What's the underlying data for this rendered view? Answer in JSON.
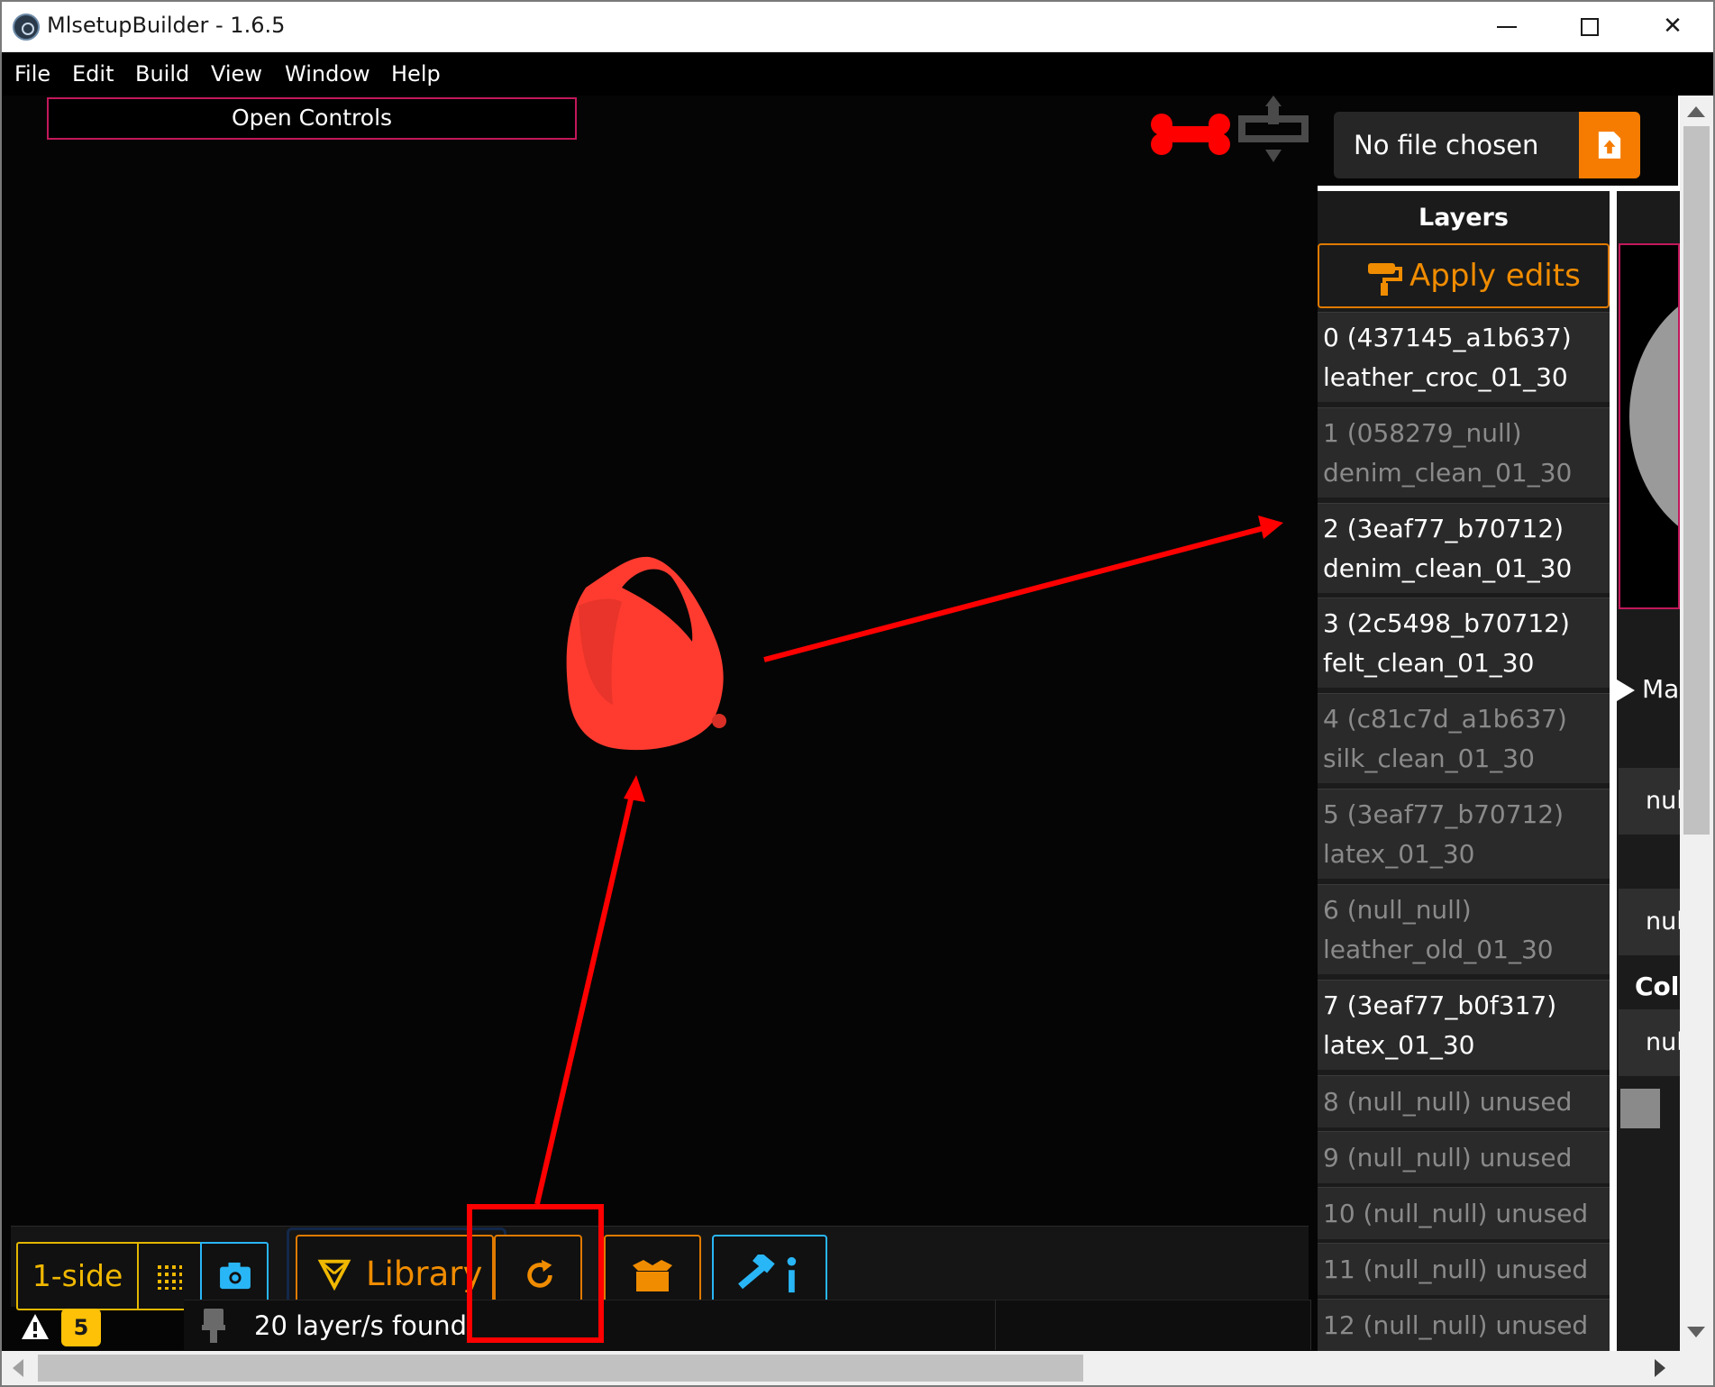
{
  "window": {
    "title": "MlsetupBuilder - 1.6.5",
    "controls": {
      "minimize": "minimize",
      "maximize": "maximize",
      "close": "✕"
    }
  },
  "menu": {
    "items": [
      "File",
      "Edit",
      "Build",
      "View",
      "Window",
      "Help"
    ]
  },
  "viewport": {
    "open_controls_label": "Open Controls",
    "icons": {
      "bone": "bone-icon",
      "move": "move-icon"
    },
    "model_color": "#ff3b30"
  },
  "file_picker": {
    "value": "No file chosen",
    "upload_icon": "file-upload-icon",
    "accent": "#f57c00"
  },
  "layers": {
    "title": "Layers",
    "apply_label": "Apply edits",
    "items": [
      {
        "id": "0 (437145_a1b637)",
        "material": "leather_croc_01_30",
        "active": true
      },
      {
        "id": "1 (058279_null)",
        "material": "denim_clean_01_30",
        "active": false
      },
      {
        "id": "2 (3eaf77_b70712)",
        "material": "denim_clean_01_30",
        "active": true
      },
      {
        "id": "3 (2c5498_b70712)",
        "material": "felt_clean_01_30",
        "active": true
      },
      {
        "id": "4 (c81c7d_a1b637)",
        "material": "silk_clean_01_30",
        "active": false
      },
      {
        "id": "5 (3eaf77_b70712)",
        "material": "latex_01_30",
        "active": false
      },
      {
        "id": "6 (null_null)",
        "material": "leather_old_01_30",
        "active": false
      },
      {
        "id": "7 (3eaf77_b0f317)",
        "material": "latex_01_30",
        "active": true
      },
      {
        "id": "8 (null_null) unused",
        "material": "",
        "active": false
      },
      {
        "id": "9 (null_null) unused",
        "material": "",
        "active": false
      },
      {
        "id": "10 (null_null) unused",
        "material": "",
        "active": false
      },
      {
        "id": "11 (null_null) unused",
        "material": "",
        "active": false
      },
      {
        "id": "12 (null_null) unused",
        "material": "",
        "active": false
      }
    ]
  },
  "right_panel": {
    "mat_toggle": "Ma",
    "null_fields": [
      "nul",
      "nul",
      "nul"
    ],
    "col_label": "Col"
  },
  "toolbar": {
    "side_label": "1-side",
    "grid_icon": "dotted-grid-icon",
    "camera_icon": "camera-icon",
    "library_label": "Library",
    "library_icon": "library-icon",
    "refresh_icon": "refresh-icon",
    "box_icon": "open-box-icon",
    "build_icon": "hammer-info-icon",
    "colors": {
      "yellow": "#e3b700",
      "orange": "#e07a00",
      "cyan": "#29b6f6"
    }
  },
  "status": {
    "warning_count": "5",
    "warning_icon": "warning-icon",
    "layers_found": "20 layer/s found",
    "brush_icon": "brush-icon"
  },
  "annotation": {
    "color": "#ff0000"
  }
}
